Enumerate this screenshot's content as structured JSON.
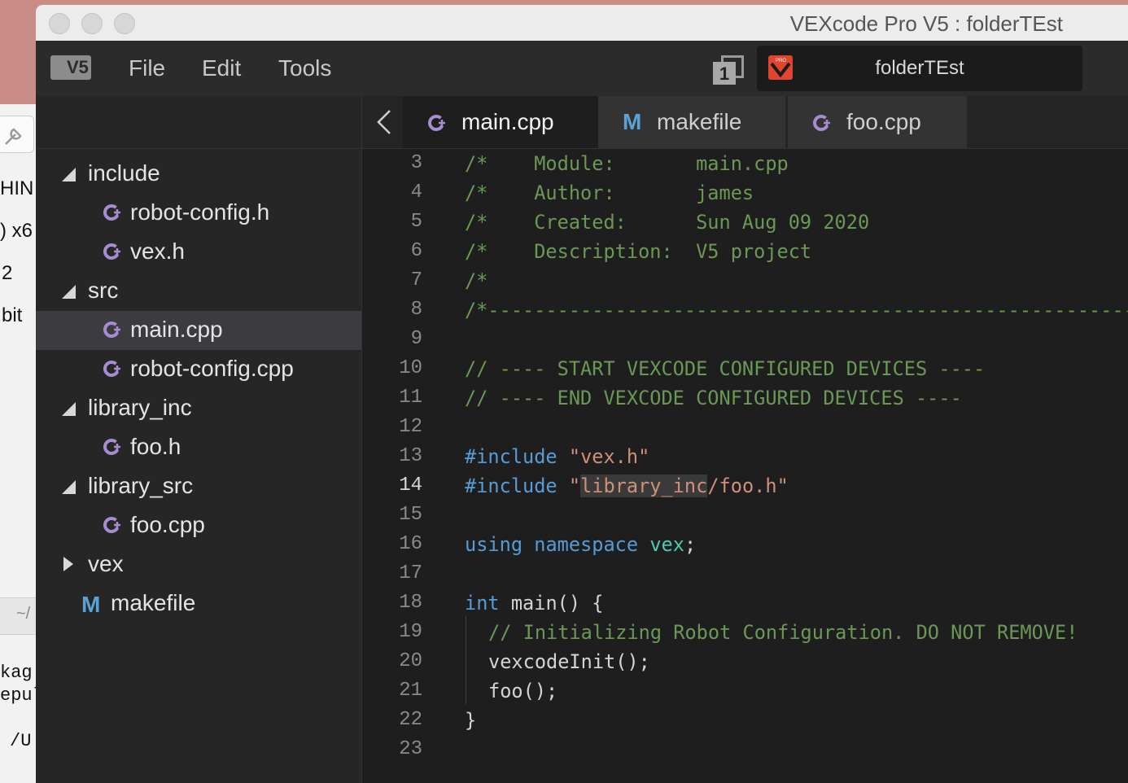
{
  "background_app": {
    "texts": [
      "HIN",
      ") x6",
      "2",
      "bit",
      "~/",
      "kag",
      "epul",
      "/U"
    ]
  },
  "window": {
    "title": "VEXcode Pro V5 : folderTEst"
  },
  "menubar": {
    "logo_text": "V5",
    "items": [
      "File",
      "Edit",
      "Tools"
    ],
    "slot_number": "1",
    "project_name": "folderTEst"
  },
  "sidebar": {
    "tree": [
      {
        "label": "include",
        "type": "folder",
        "expanded": true
      },
      {
        "label": "robot-config.h",
        "type": "cpp"
      },
      {
        "label": "vex.h",
        "type": "cpp"
      },
      {
        "label": "src",
        "type": "folder",
        "expanded": true
      },
      {
        "label": "main.cpp",
        "type": "cpp",
        "selected": true
      },
      {
        "label": "robot-config.cpp",
        "type": "cpp"
      },
      {
        "label": "library_inc",
        "type": "folder",
        "expanded": true
      },
      {
        "label": "foo.h",
        "type": "cpp"
      },
      {
        "label": "library_src",
        "type": "folder",
        "expanded": true
      },
      {
        "label": "foo.cpp",
        "type": "cpp"
      },
      {
        "label": "vex",
        "type": "folder",
        "expanded": false
      },
      {
        "label": "makefile",
        "type": "makefile"
      }
    ]
  },
  "tabs": [
    {
      "label": "main.cpp",
      "icon": "cpp-file-icon",
      "active": true
    },
    {
      "label": "makefile",
      "icon": "makefile-icon",
      "active": false
    },
    {
      "label": "foo.cpp",
      "icon": "cpp-file-icon",
      "active": false
    }
  ],
  "editor": {
    "line_numbers": [
      "3",
      "4",
      "5",
      "6",
      "7",
      "8",
      "9",
      "10",
      "11",
      "12",
      "13",
      "14",
      "15",
      "16",
      "17",
      "18",
      "19",
      "20",
      "21",
      "22",
      "23"
    ],
    "current_line": "14",
    "code": {
      "l3": "/*    Module:       main.cpp",
      "l4": "/*    Author:       james",
      "l5": "/*    Created:      Sun Aug 09 2020",
      "l6": "/*    Description:  V5 project",
      "l7": "/*",
      "l8": "/*----------------------------------------------------------------------",
      "l10": "// ---- START VEXCODE CONFIGURED DEVICES ----",
      "l11": "// ---- END VEXCODE CONFIGURED DEVICES ----",
      "l13_kw": "#include",
      "l13_str": "\"vex.h\"",
      "l14_kw": "#include",
      "l14_q1": "\"",
      "l14_hl": "library_inc",
      "l14_rest": "/foo.h\"",
      "l16_kw1": "using",
      "l16_kw2": "namespace",
      "l16_ns": "vex",
      "l16_end": ";",
      "l18_kw": "int",
      "l18_rest": " main() {",
      "l19": "// Initializing Robot Configuration. DO NOT REMOVE!",
      "l20": "vexcodeInit();",
      "l21": "foo();",
      "l22": "}"
    }
  },
  "colors": {
    "comment": "#6a9955",
    "keyword": "#569cd6",
    "string": "#ce9178",
    "namespace": "#4ec9b0",
    "cpp_icon": "#a98bd1",
    "makefile_icon": "#5aa3d6",
    "vex_red": "#e0452e"
  }
}
